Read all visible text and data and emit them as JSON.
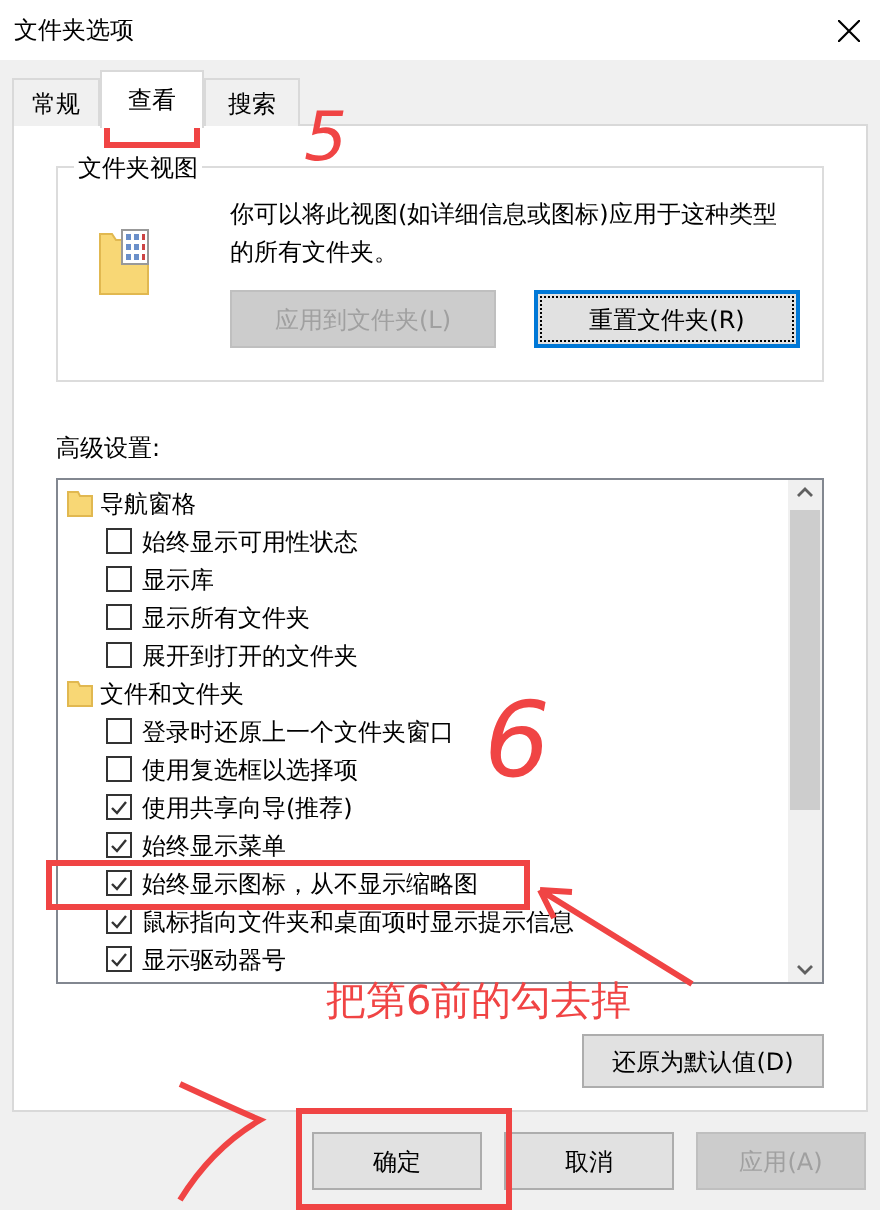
{
  "window": {
    "title": "文件夹选项"
  },
  "tabs": [
    {
      "label": "常规",
      "selected": false
    },
    {
      "label": "查看",
      "selected": true
    },
    {
      "label": "搜索",
      "selected": false
    }
  ],
  "folder_views": {
    "title": "文件夹视图",
    "description": "你可以将此视图(如详细信息或图标)应用于这种类型的所有文件夹。",
    "buttons": [
      {
        "label": "应用到文件夹(L)",
        "disabled": true,
        "default": false
      },
      {
        "label": "重置文件夹(R)",
        "disabled": false,
        "default": true
      }
    ]
  },
  "advanced": {
    "label": "高级设置:",
    "items": [
      {
        "kind": "group",
        "label": "导航窗格",
        "children": [
          {
            "kind": "checkbox",
            "label": "始终显示可用性状态",
            "checked": false
          },
          {
            "kind": "checkbox",
            "label": "显示库",
            "checked": false
          },
          {
            "kind": "checkbox",
            "label": "显示所有文件夹",
            "checked": false
          },
          {
            "kind": "checkbox",
            "label": "展开到打开的文件夹",
            "checked": false
          }
        ]
      },
      {
        "kind": "group",
        "label": "文件和文件夹",
        "children": [
          {
            "kind": "checkbox",
            "label": "登录时还原上一个文件夹窗口",
            "checked": false
          },
          {
            "kind": "checkbox",
            "label": "使用复选框以选择项",
            "checked": false
          },
          {
            "kind": "checkbox",
            "label": "使用共享向导(推荐)",
            "checked": true
          },
          {
            "kind": "checkbox",
            "label": "始终显示菜单",
            "checked": true
          },
          {
            "kind": "checkbox",
            "label": "始终显示图标，从不显示缩略图",
            "checked": true
          },
          {
            "kind": "checkbox",
            "label": "鼠标指向文件夹和桌面项时显示提示信息",
            "checked": true
          },
          {
            "kind": "checkbox",
            "label": "显示驱动器号",
            "checked": true
          }
        ]
      }
    ],
    "restore_button": "还原为默认值(D)"
  },
  "dialog_buttons": [
    {
      "label": "确定",
      "disabled": false
    },
    {
      "label": "取消",
      "disabled": false
    },
    {
      "label": "应用(A)",
      "disabled": true
    }
  ],
  "annotations": [
    {
      "kind": "digit",
      "text": "5"
    },
    {
      "kind": "digit",
      "text": "6"
    },
    {
      "kind": "note",
      "text": "把第6前的勾去掉"
    }
  ]
}
